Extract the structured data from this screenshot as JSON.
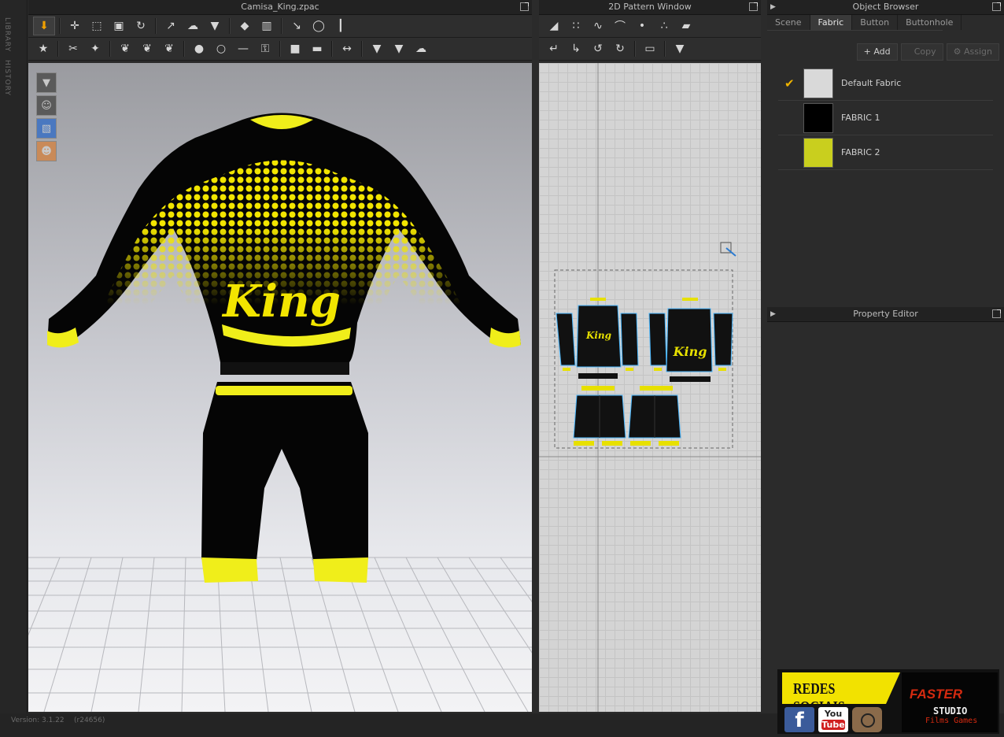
{
  "left_strip": {
    "library": "LIBRARY",
    "history": "HISTORY"
  },
  "window3d": {
    "title": "Camisa_King.zpac"
  },
  "window2d": {
    "title": "2D Pattern Window"
  },
  "object_browser": {
    "title": "Object Browser",
    "tabs": [
      "Scene",
      "Fabric",
      "Button",
      "Buttonhole"
    ],
    "active_tab": "Fabric",
    "actions": {
      "add": "Add",
      "copy": "Copy",
      "assign": "Assign"
    },
    "fabrics": [
      {
        "name": "Default Fabric",
        "color": "#d9d9d9",
        "checked": true
      },
      {
        "name": "FABRIC 1",
        "color": "#000000",
        "checked": false
      },
      {
        "name": "FABRIC 2",
        "color": "#c9cf1e",
        "checked": false
      }
    ]
  },
  "property_editor": {
    "title": "Property Editor"
  },
  "status": {
    "version": "Version: 3.1.22",
    "revision": "(r24656)"
  },
  "garment_text": "King",
  "banner": {
    "title": "REDES SOCIAIS",
    "facebook": "f",
    "youtube_you": "You",
    "youtube_tube": "Tube",
    "brand": "FASTER",
    "studio": "STUDIO",
    "films_games": "Films Games"
  },
  "colors": {
    "accent_yellow": "#f2e500",
    "panel_bg": "#2b2b2b",
    "highlight": "#f0b400"
  }
}
